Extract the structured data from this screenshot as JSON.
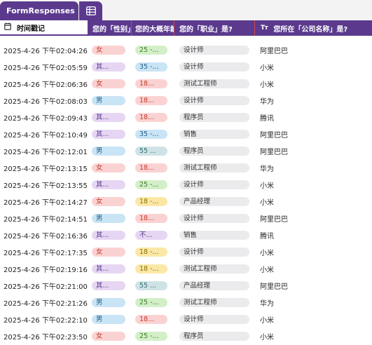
{
  "tab": {
    "title": "FormResponses"
  },
  "headers": {
    "time": "时间戳记",
    "q1": "您的「性别」是?",
    "q2": "您的大概年龄是?",
    "q3": "您的「职业」是?",
    "q4": "您所在「公司名称」是?"
  },
  "colors": {
    "accent": "#5b3a8e",
    "pill_red_bg": "#fbd2d2",
    "pill_red_fg": "#c0392b",
    "pill_purple_bg": "#e6d6f3",
    "pill_purple_fg": "#5b3a8e",
    "pill_blue_bg": "#c9e4f5",
    "pill_blue_fg": "#1f5f8b",
    "pill_green_bg": "#d3efc8",
    "pill_green_fg": "#3d7a2a",
    "pill_yellow_bg": "#fbe8a6",
    "pill_yellow_fg": "#8a6d00",
    "pill_teal_bg": "#cfe3e6",
    "pill_teal_fg": "#2f6b73",
    "pill_gray_bg": "#ebebed"
  },
  "rows": [
    {
      "time": "2025-4-26 下午02:04:26",
      "q1": "女",
      "q1c": "red",
      "q2": "25 -...",
      "q2c": "green",
      "q3": "设计师",
      "q4": "阿里巴巴"
    },
    {
      "time": "2025-4-26 下午02:05:59",
      "q1": "其...",
      "q1c": "purple",
      "q2": "35 -...",
      "q2c": "blue",
      "q3": "设计师",
      "q4": "小米"
    },
    {
      "time": "2025-4-26 下午02:06:36",
      "q1": "女",
      "q1c": "red",
      "q2": "18...",
      "q2c": "red",
      "q3": "测试工程师",
      "q4": "小米"
    },
    {
      "time": "2025-4-26 下午02:08:03",
      "q1": "男",
      "q1c": "blue",
      "q2": "18...",
      "q2c": "red",
      "q3": "设计师",
      "q4": "华为"
    },
    {
      "time": "2025-4-26 下午02:09:43",
      "q1": "其...",
      "q1c": "purple",
      "q2": "18...",
      "q2c": "red",
      "q3": "程序员",
      "q4": "腾讯"
    },
    {
      "time": "2025-4-26 下午02:10:49",
      "q1": "其...",
      "q1c": "purple",
      "q2": "35 -...",
      "q2c": "blue",
      "q3": "销售",
      "q4": "阿里巴巴"
    },
    {
      "time": "2025-4-26 下午02:12:01",
      "q1": "男",
      "q1c": "blue",
      "q2": "55 ...",
      "q2c": "teal",
      "q3": "程序员",
      "q4": "阿里巴巴"
    },
    {
      "time": "2025-4-26 下午02:13:15",
      "q1": "女",
      "q1c": "red",
      "q2": "18...",
      "q2c": "red",
      "q3": "测试工程师",
      "q4": "华为"
    },
    {
      "time": "2025-4-26 下午02:13:55",
      "q1": "其...",
      "q1c": "purple",
      "q2": "25 -...",
      "q2c": "green",
      "q3": "设计师",
      "q4": "小米"
    },
    {
      "time": "2025-4-26 下午02:14:27",
      "q1": "女",
      "q1c": "red",
      "q2": "18 -...",
      "q2c": "yellow",
      "q3": "产品经理",
      "q4": "小米"
    },
    {
      "time": "2025-4-26 下午02:14:51",
      "q1": "男",
      "q1c": "blue",
      "q2": "18...",
      "q2c": "red",
      "q3": "设计师",
      "q4": "阿里巴巴"
    },
    {
      "time": "2025-4-26 下午02:16:36",
      "q1": "其...",
      "q1c": "purple",
      "q2": "不...",
      "q2c": "purple",
      "q3": "销售",
      "q4": "腾讯"
    },
    {
      "time": "2025-4-26 下午02:17:35",
      "q1": "女",
      "q1c": "red",
      "q2": "18 -...",
      "q2c": "yellow",
      "q3": "设计师",
      "q4": "小米"
    },
    {
      "time": "2025-4-26 下午02:19:16",
      "q1": "其...",
      "q1c": "purple",
      "q2": "18 -...",
      "q2c": "yellow",
      "q3": "测试工程师",
      "q4": "小米"
    },
    {
      "time": "2025-4-26 下午02:21:00",
      "q1": "其...",
      "q1c": "purple",
      "q2": "55 ...",
      "q2c": "teal",
      "q3": "产品经理",
      "q4": "阿里巴巴"
    },
    {
      "time": "2025-4-26 下午02:21:26",
      "q1": "男",
      "q1c": "blue",
      "q2": "25 -...",
      "q2c": "green",
      "q3": "测试工程师",
      "q4": "华为"
    },
    {
      "time": "2025-4-26 下午02:22:10",
      "q1": "男",
      "q1c": "blue",
      "q2": "18...",
      "q2c": "red",
      "q3": "设计师",
      "q4": "小米"
    },
    {
      "time": "2025-4-26 下午02:23:50",
      "q1": "女",
      "q1c": "red",
      "q2": "25 -...",
      "q2c": "green",
      "q3": "程序员",
      "q4": "小米"
    }
  ]
}
